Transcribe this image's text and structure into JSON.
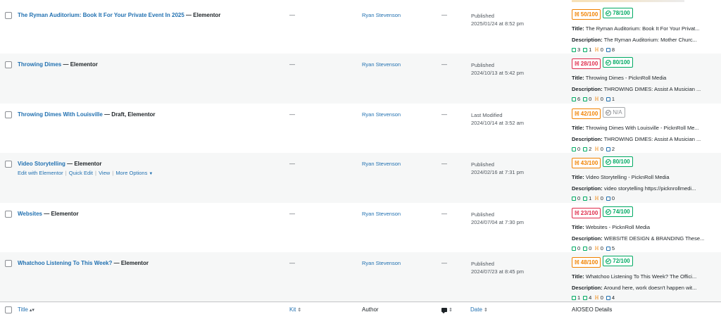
{
  "columns": {
    "title": "Title",
    "kit": "Kit",
    "author": "Author",
    "date": "Date",
    "aioseo": "AIOSEO Details"
  },
  "rows": [
    {
      "title": "The Ryman Auditorium: Book It For Your Private Event In 2025",
      "state": "— Elementor",
      "kit": "—",
      "author": "Ryan Stevenson",
      "comments": "—",
      "date_status": "Published",
      "date_value": "2025/01/24 at 8:52 pm",
      "trueseo": "50/100",
      "trueseo_color": "orange",
      "headline": "78/100",
      "headline_color": "green",
      "seo_title": "The Ryman Auditorium: Book It For Your Privat...",
      "seo_description": "The Ryman Auditorium: Mother Churc...",
      "internal": "3",
      "external": "1",
      "affiliate": "0",
      "outbound": "8"
    },
    {
      "title": "Throwing Dimes",
      "state": "— Elementor",
      "kit": "—",
      "author": "Ryan Stevenson",
      "comments": "—",
      "date_status": "Published",
      "date_value": "2024/10/13 at 5:42 pm",
      "trueseo": "28/100",
      "trueseo_color": "red",
      "headline": "80/100",
      "headline_color": "green",
      "seo_title": "Throwing Dimes - PicknRoll Media",
      "seo_description": "THROWING DIMES: Assist A Musician ...",
      "internal": "6",
      "external": "0",
      "affiliate": "0",
      "outbound": "1"
    },
    {
      "title": "Throwing Dimes With Louisville",
      "state": "— Draft, Elementor",
      "kit": "—",
      "author": "Ryan Stevenson",
      "comments": "—",
      "date_status": "Last Modified",
      "date_value": "2024/10/14 at 3:52 am",
      "trueseo": "42/100",
      "trueseo_color": "orange",
      "headline": "N/A",
      "headline_color": "gray",
      "seo_title": "Throwing Dimes With Louisville - PicknRoll Me...",
      "seo_description": "THROWING DIMES: Assist A Musician ...",
      "internal": "0",
      "external": "2",
      "affiliate": "0",
      "outbound": "2"
    },
    {
      "title": "Video Storytelling",
      "state": "— Elementor",
      "kit": "—",
      "author": "Ryan Stevenson",
      "comments": "—",
      "date_status": "Published",
      "date_value": "2024/02/16 at 7:31 pm",
      "trueseo": "43/100",
      "trueseo_color": "orange",
      "headline": "80/100",
      "headline_color": "green",
      "seo_title": "Video Storytelling - PicknRoll Media",
      "seo_description": "video storytelling https://picknrollmedi...",
      "internal": "0",
      "external": "1",
      "affiliate": "0",
      "outbound": "0",
      "actions": {
        "edit_elementor": "Edit with Elementor",
        "quick_edit": "Quick Edit",
        "view": "View",
        "more": "More Options"
      }
    },
    {
      "title": "Websites",
      "state": "— Elementor",
      "kit": "—",
      "author": "Ryan Stevenson",
      "comments": "—",
      "date_status": "Published",
      "date_value": "2024/07/04 at 7:30 pm",
      "trueseo": "23/100",
      "trueseo_color": "red",
      "headline": "74/100",
      "headline_color": "green",
      "seo_title": "Websites - PicknRoll Media",
      "seo_description": "WEBSITE DESIGN & BRANDING These...",
      "internal": "0",
      "external": "0",
      "affiliate": "0",
      "outbound": "5"
    },
    {
      "title": "Whatchoo Listening To This Week?",
      "state": "— Elementor",
      "kit": "—",
      "author": "Ryan Stevenson",
      "comments": "—",
      "date_status": "Published",
      "date_value": "2024/07/23 at 8:45 pm",
      "trueseo": "48/100",
      "trueseo_color": "orange",
      "headline": "72/100",
      "headline_color": "green",
      "seo_title": "Whatchoo Listening To This Week? The Offici...",
      "seo_description": "Around here, work doesn't happen wit...",
      "internal": "1",
      "external": "4",
      "affiliate": "0",
      "outbound": "4"
    }
  ],
  "labels": {
    "title_prefix": "Title:",
    "description_prefix": "Description:"
  },
  "colors": {
    "link": "#2271b1",
    "orange": "#f18200",
    "red": "#df2a4a",
    "green": "#00aa63",
    "gray": "#8c8f94"
  }
}
